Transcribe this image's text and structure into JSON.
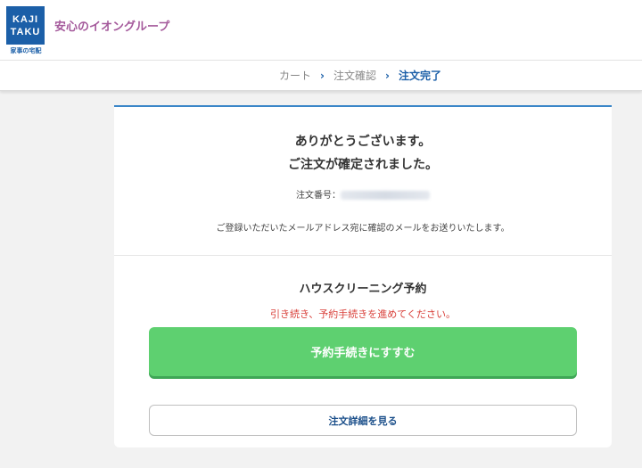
{
  "header": {
    "logo_line1": "KAJI",
    "logo_line2": "TAKU",
    "logo_sub": "家事の宅配",
    "tagline": "安心のイオングループ"
  },
  "breadcrumb": {
    "items": [
      "カート",
      "注文確認",
      "注文完了"
    ],
    "separator": "›"
  },
  "confirmation": {
    "thanks_line1": "ありがとうございます。",
    "thanks_line2": "ご注文が確定されました。",
    "order_label": "注文番号：",
    "order_number": "kaj0015566243089",
    "mail_note": "ご登録いただいたメールアドレス宛に確認のメールをお送りいたします。"
  },
  "reservation": {
    "title": "ハウスクリーニング予約",
    "notice": "引き続き、予約手続きを進めてください。",
    "primary_button": "予約手続きにすすむ",
    "secondary_button": "注文詳細を見る"
  },
  "colors": {
    "brand_blue": "#1b5fa8",
    "tagline_purple": "#a4599b",
    "accent_green": "#5ed070",
    "notice_red": "#d9413b"
  }
}
